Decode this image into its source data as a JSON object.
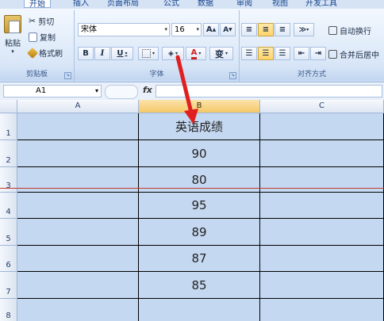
{
  "ribbon": {
    "tabs": [
      "开始",
      "插入",
      "页面布局",
      "公式",
      "数据",
      "审阅",
      "视图",
      "开发工具"
    ],
    "clipboard": {
      "paste_label": "粘贴",
      "cut_label": "剪切",
      "copy_label": "复制",
      "format_painter_label": "格式刷",
      "group_label": "剪贴板"
    },
    "font": {
      "font_name": "宋体",
      "font_size": "16",
      "grow_label": "A",
      "shrink_label": "A",
      "bold_label": "B",
      "italic_label": "I",
      "underline_label": "U",
      "font_color_label": "A",
      "phonetic_label": "变",
      "group_label": "字体",
      "font_color_hex": "#d22020"
    },
    "alignment": {
      "wrap_label": "自动换行",
      "merge_label": "合并后居中",
      "group_label": "对齐方式"
    }
  },
  "formula_bar": {
    "cell_ref": "A1",
    "fx_label": "fx",
    "formula": ""
  },
  "sheet": {
    "columns": [
      "A",
      "B",
      "C"
    ],
    "selected_column": "B",
    "rows": [
      "1",
      "2",
      "3",
      "4",
      "5",
      "6",
      "7",
      "8"
    ],
    "column_b_values": [
      "英语成绩",
      "90",
      "80",
      "95",
      "89",
      "87",
      "85",
      ""
    ],
    "cell_fill_hex": "#c5d8f1"
  },
  "annotation": {
    "arrow_color_hex": "#e02020",
    "line_color_hex": "#c0392b"
  }
}
